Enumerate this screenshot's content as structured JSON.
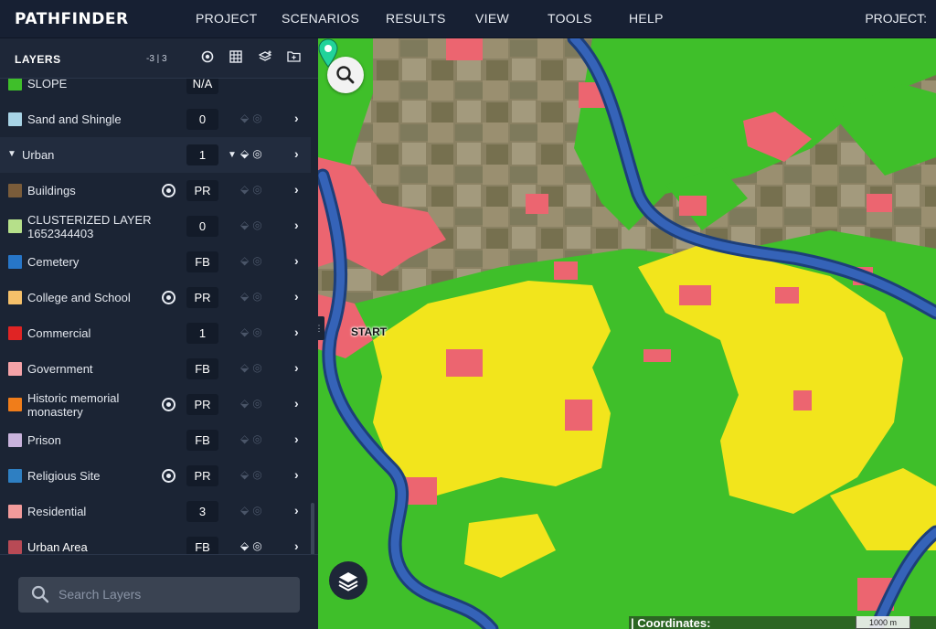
{
  "app": {
    "logo": "PATHFINDER",
    "nav": [
      "PROJECT",
      "SCENARIOS",
      "RESULTS",
      "VIEW",
      "TOOLS",
      "HELP"
    ],
    "project_label": "PROJECT:"
  },
  "sidebar": {
    "title": "LAYERS",
    "count": "-3 | 3",
    "header_icons": [
      "target-icon",
      "grid-icon",
      "layers-add-icon",
      "folder-icon"
    ],
    "partial_row": {
      "name": "SLOPE",
      "badge": "N/A"
    },
    "rows": [
      {
        "name": "Sand and Shingle",
        "color": "#a8d4e6",
        "target": false,
        "badge": "0",
        "vis_on": false
      },
      {
        "group": true,
        "name": "Urban",
        "badge": "1"
      },
      {
        "name": "Buildings",
        "color": "#7a5c3a",
        "target": true,
        "badge": "PR",
        "vis_on": false
      },
      {
        "name": "CLUSTERIZED LAYER 1652344403",
        "color": "#b6e08a",
        "target": false,
        "badge": "0",
        "vis_on": false
      },
      {
        "name": "Cemetery",
        "color": "#2776c8",
        "target": false,
        "badge": "FB",
        "vis_on": false
      },
      {
        "name": "College and School",
        "color": "#f5c06a",
        "target": true,
        "badge": "PR",
        "vis_on": false
      },
      {
        "name": "Commercial",
        "color": "#e02424",
        "target": false,
        "badge": "1",
        "vis_on": false
      },
      {
        "name": "Government",
        "color": "#f5a3a8",
        "target": false,
        "badge": "FB",
        "vis_on": false
      },
      {
        "name": "Historic memorial monastery",
        "color": "#f07d1a",
        "target": true,
        "badge": "PR",
        "vis_on": false
      },
      {
        "name": "Prison",
        "color": "#c9b3dc",
        "target": false,
        "badge": "FB",
        "vis_on": false
      },
      {
        "name": "Religious Site",
        "color": "#2e7fc2",
        "target": true,
        "badge": "PR",
        "vis_on": false
      },
      {
        "name": "Residential",
        "color": "#f29b9b",
        "target": false,
        "badge": "3",
        "vis_on": false
      },
      {
        "name": "Urban Area",
        "color": "#b84a55",
        "target": false,
        "badge": "FB",
        "vis_on": true
      }
    ],
    "search_placeholder": "Search Layers"
  },
  "map": {
    "start_label": "START",
    "coordinates_label": "| Coordinates:",
    "scale_label": "1000 m",
    "colors": {
      "green": "#3fbf2a",
      "yellow": "#f2e51c",
      "river": "#2f5fae",
      "urban": "#ec6570"
    }
  }
}
